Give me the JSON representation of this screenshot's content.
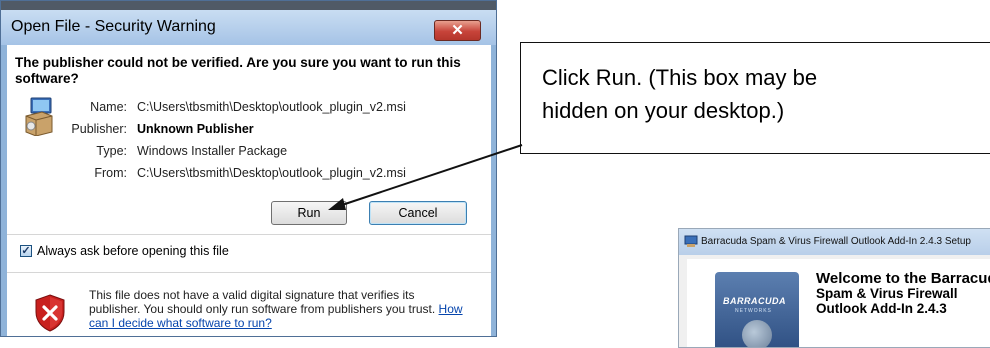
{
  "dialog": {
    "title": "Open File - Security Warning",
    "close_glyph": "✕",
    "heading": "The publisher could not be verified.  Are you sure you want to run this software?",
    "package_icon": "installer-package-icon",
    "fields": {
      "name_label": "Name:",
      "name_value": "C:\\Users\\tbsmith\\Desktop\\outlook_plugin_v2.msi",
      "publisher_label": "Publisher:",
      "publisher_value": "Unknown Publisher",
      "type_label": "Type:",
      "type_value": "Windows Installer Package",
      "from_label": "From:",
      "from_value": "C:\\Users\\tbsmith\\Desktop\\outlook_plugin_v2.msi"
    },
    "run_label": "Run",
    "cancel_label": "Cancel",
    "checkbox_label": "Always ask before opening this file",
    "checkbox_checked": true,
    "warning_icon": "shield-x-icon",
    "warning_text": "This file does not have a valid digital signature that verifies its publisher.  You should only run software from publishers you trust.",
    "link_text": "How can I decide what software to run?"
  },
  "callout": {
    "text": "Click Run. (This box may be hidden on your desktop.)"
  },
  "installer": {
    "title": "Barracuda Spam & Virus Firewall Outlook Add-In 2.4.3 Setup",
    "logo_text": "BARRACUDA",
    "logo_subtext": "NETWORKS",
    "welcome_line1": "Welcome to the Barracuda",
    "welcome_line2": "Spam & Virus Firewall",
    "welcome_line3": "Outlook Add-In 2.4.3"
  },
  "colors": {
    "dialog_frame": "#8fb3d9",
    "close_button": "#c7443a",
    "link": "#0645ad",
    "installer_logo": "#2e4f82"
  }
}
